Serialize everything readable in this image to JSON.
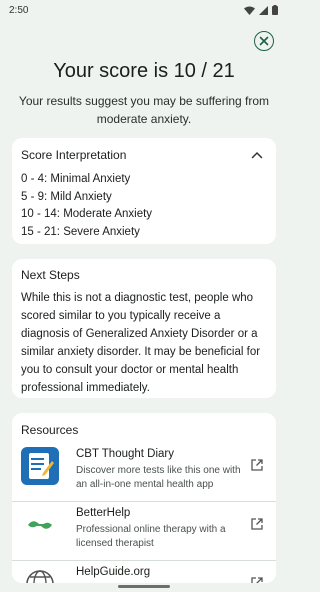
{
  "status_bar": {
    "time": "2:50"
  },
  "result": {
    "title": "Your score is 10 / 21",
    "subtitle": "Your results suggest you may be suffering from moderate anxiety."
  },
  "interpretation": {
    "title": "Score Interpretation",
    "ranges": [
      "0 - 4: Minimal Anxiety",
      "5 - 9: Mild Anxiety",
      "10 - 14: Moderate Anxiety",
      "15 - 21: Severe Anxiety"
    ]
  },
  "next_steps": {
    "title": "Next Steps",
    "body": "While this is not a diagnostic test, people who scored similar to you typically receive a diagnosis of Generalized Anxiety Disorder or a similar anxiety disorder. It may be beneficial for you to consult your doctor or mental health professional immediately."
  },
  "resources": {
    "title": "Resources",
    "items": [
      {
        "name": "CBT Thought Diary",
        "description": "Discover more tests like this one with an all-in-one mental health app",
        "icon": "diary-app-icon"
      },
      {
        "name": "BetterHelp",
        "description": "Professional online therapy with a licensed therapist",
        "icon": "betterhelp-logo-icon"
      },
      {
        "name": "HelpGuide.org",
        "description": "",
        "icon": "globe-icon"
      }
    ]
  },
  "colors": {
    "accent": "#1f5f4a",
    "background": "#eef3ef",
    "card": "#ffffff"
  }
}
